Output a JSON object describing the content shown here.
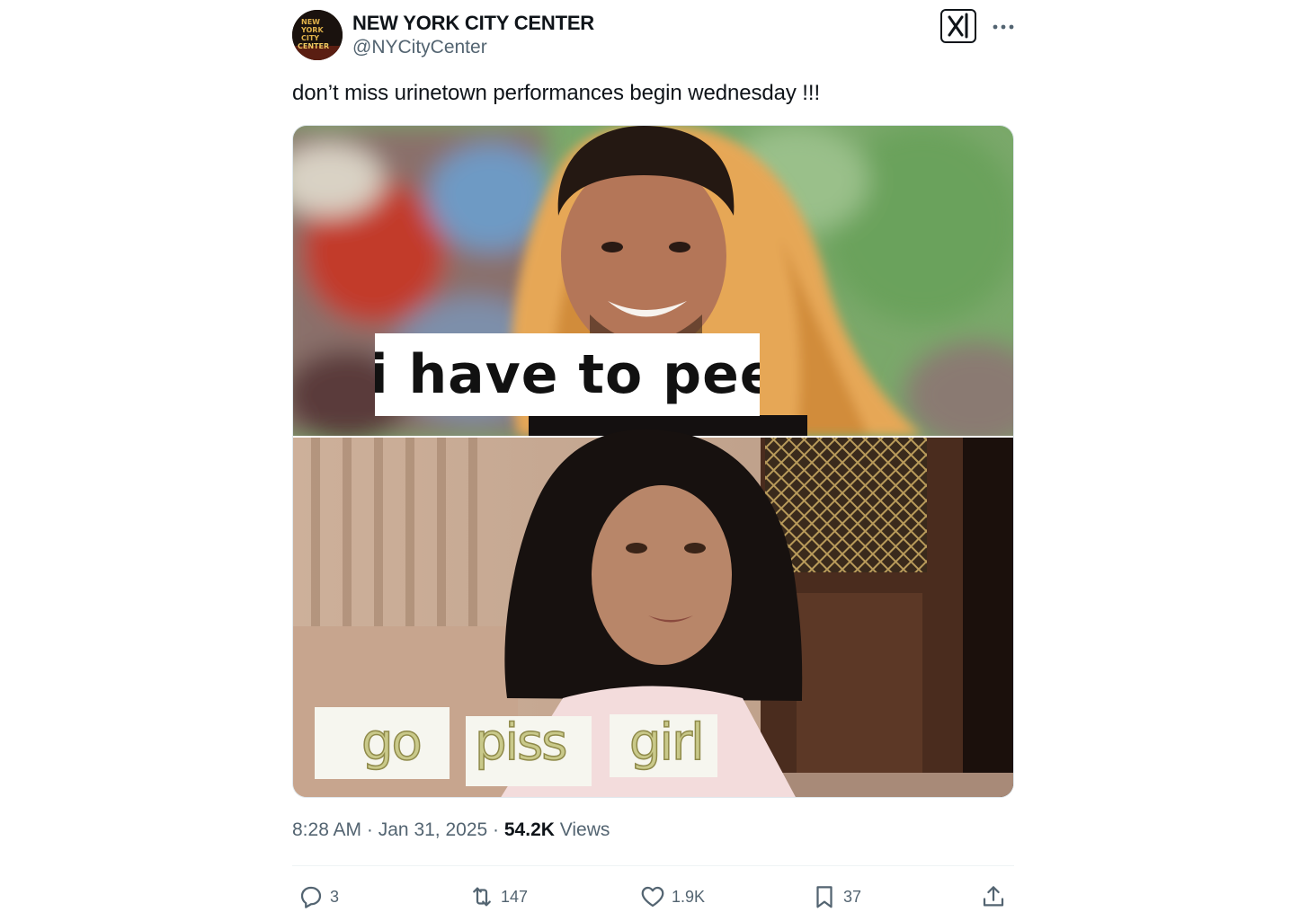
{
  "author": {
    "name": "NEW YORK CITY CENTER",
    "handle": "@NYCityCenter",
    "avatar_text": [
      "NEW",
      "YORK",
      "CITY",
      "CENTER"
    ]
  },
  "tweet": {
    "text": "don’t miss urinetown performances begin wednesday !!!"
  },
  "media": {
    "caption_top": "i have to pee",
    "caption_bottom": [
      "go",
      "piss",
      "girl"
    ]
  },
  "meta": {
    "time": "8:28 AM",
    "separator": "·",
    "date": "Jan 31, 2025",
    "views_count": "54.2K",
    "views_label": "Views"
  },
  "actions": {
    "replies": "3",
    "reposts": "147",
    "likes": "1.9K",
    "bookmarks": "37"
  },
  "icons": {
    "reply": "reply-icon",
    "repost": "repost-icon",
    "like": "heart-icon",
    "bookmark": "bookmark-icon",
    "share": "share-icon",
    "grok": "grok-icon",
    "more": "more-icon"
  }
}
